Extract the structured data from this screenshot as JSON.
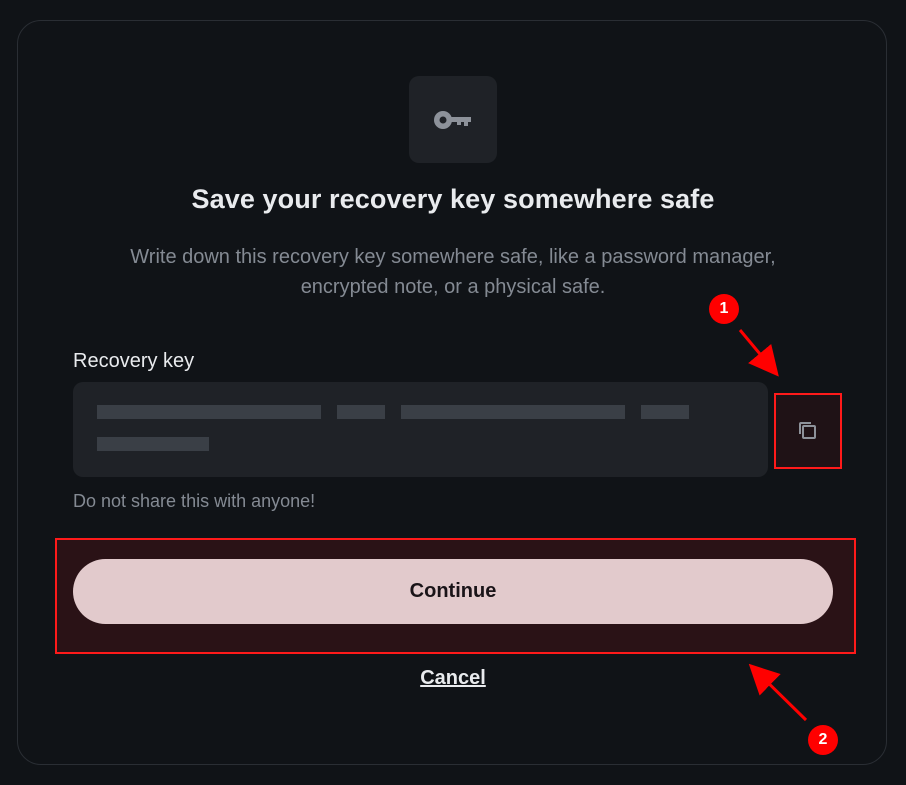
{
  "dialog": {
    "icon": "key-icon",
    "title": "Save your recovery key somewhere safe",
    "subtitle": "Write down this recovery key somewhere safe, like a password manager, encrypted note, or a physical safe.",
    "recovery_key_label": "Recovery key",
    "recovery_key_value": "",
    "copy_icon": "copy-icon",
    "warning": "Do not share this with anyone!",
    "continue_label": "Continue",
    "cancel_label": "Cancel"
  },
  "annotations": {
    "markers": [
      {
        "label": "1"
      },
      {
        "label": "2"
      }
    ],
    "color": "#ff0000"
  },
  "colors": {
    "background": "#101317",
    "surface": "#1f2227",
    "primary_button": "#e2cacc",
    "text_primary": "#e9ebee",
    "text_secondary": "#848a93"
  }
}
